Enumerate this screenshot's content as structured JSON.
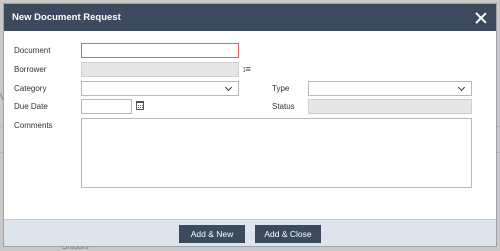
{
  "background": {
    "partial_text": "Shibani",
    "edge_char_left": "V",
    "edge_char_right": "t"
  },
  "dialog": {
    "title": "New Document Request",
    "close_icon": "close-icon"
  },
  "form": {
    "document": {
      "label": "Document",
      "value": ""
    },
    "borrower": {
      "label": "Borrower",
      "value": "",
      "icon": "sort-icon",
      "icon_glyph": "↕≡"
    },
    "category": {
      "label": "Category",
      "value": ""
    },
    "type": {
      "label": "Type",
      "value": ""
    },
    "due_date": {
      "label": "Due Date",
      "value": "",
      "icon": "calendar-icon"
    },
    "status": {
      "label": "Status",
      "value": ""
    },
    "comments": {
      "label": "Comments",
      "value": ""
    }
  },
  "footer": {
    "add_new_label": "Add & New",
    "add_close_label": "Add & Close"
  },
  "colors": {
    "titlebar": "#3b4a5c",
    "button": "#3b4a5c",
    "footer": "#dde4ec",
    "error_border": "#e06060"
  }
}
